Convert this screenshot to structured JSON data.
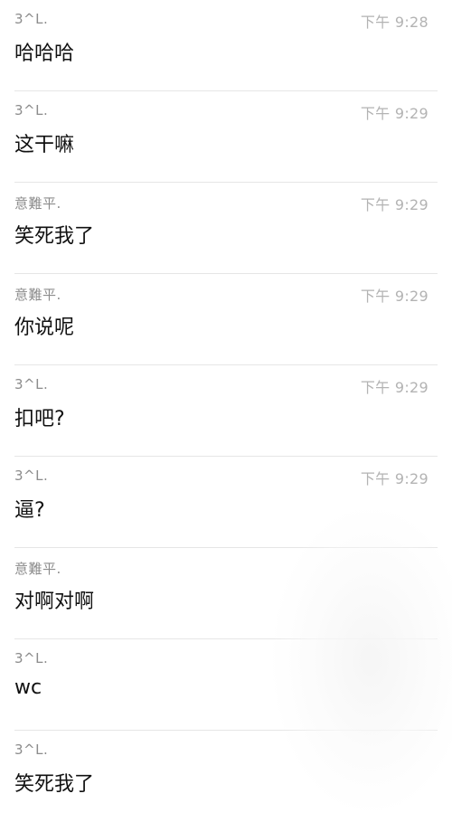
{
  "messages": [
    {
      "sender": "3^L.",
      "time": "下午 9:28",
      "text": "哈哈哈"
    },
    {
      "sender": "3^L.",
      "time": "下午 9:29",
      "text": "这干嘛"
    },
    {
      "sender": "意難平.",
      "time": "下午 9:29",
      "text": "笑死我了"
    },
    {
      "sender": "意難平.",
      "time": "下午 9:29",
      "text": "你说呢"
    },
    {
      "sender": "3^L.",
      "time": "下午 9:29",
      "text": "扣吧?"
    },
    {
      "sender": "3^L.",
      "time": "下午 9:29",
      "text": "逼?"
    },
    {
      "sender": "意難平.",
      "time": "",
      "text": "对啊对啊"
    },
    {
      "sender": "3^L.",
      "time": "",
      "text": "wc"
    },
    {
      "sender": "3^L.",
      "time": "",
      "text": "笑死我了"
    }
  ]
}
